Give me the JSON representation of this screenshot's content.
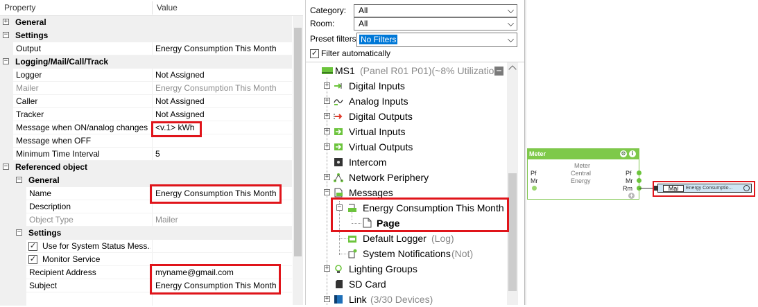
{
  "property_grid": {
    "header": {
      "property": "Property",
      "value": "Value"
    },
    "rows": [
      {
        "label": "General",
        "type": "category",
        "collapsed": true
      },
      {
        "label": "Settings",
        "type": "category"
      },
      {
        "label": "Output",
        "value": "Energy Consumption This Month"
      },
      {
        "label": "Logging/Mail/Call/Track",
        "type": "category"
      },
      {
        "label": "Logger",
        "value": "Not Assigned"
      },
      {
        "label": "Mailer",
        "value": "Energy Consumption This Month",
        "disabled": true
      },
      {
        "label": "Caller",
        "value": "Not Assigned"
      },
      {
        "label": "Tracker",
        "value": "Not Assigned"
      },
      {
        "label": "Message when ON/analog changes",
        "value": "<v.1> kWh"
      },
      {
        "label": "Message when OFF",
        "value": ""
      },
      {
        "label": "Minimum Time Interval",
        "value": "5"
      },
      {
        "label": "Referenced object",
        "type": "category"
      },
      {
        "label": "General",
        "type": "subcategory"
      },
      {
        "label": "Name",
        "value": "Energy Consumption This Month"
      },
      {
        "label": "Description",
        "value": ""
      },
      {
        "label": "Object Type",
        "value": "Mailer",
        "disabled": true
      },
      {
        "label": "Settings",
        "type": "subcategory"
      },
      {
        "label": "Use for System Status Mess...",
        "value": "",
        "checked": true
      },
      {
        "label": "Monitor Service",
        "value": "",
        "checked": true
      },
      {
        "label": "Recipient Address",
        "value": "myname@gmail.com"
      },
      {
        "label": "Subject",
        "value": "Energy Consumption This Month"
      }
    ]
  },
  "filters": {
    "category_label": "Category:",
    "category_value": "All",
    "room_label": "Room:",
    "room_value": "All",
    "preset_label": "Preset filters",
    "preset_value": "No Filters",
    "auto_label": "Filter automatically",
    "auto_checked": true
  },
  "tree": {
    "root": {
      "label": "MS1",
      "detail": "(Panel R01 P01)(~8% Utilization"
    },
    "items": [
      {
        "label": "Digital Inputs",
        "icon": "digital-inputs-icon"
      },
      {
        "label": "Analog Inputs",
        "icon": "analog-inputs-icon"
      },
      {
        "label": "Digital Outputs",
        "icon": "digital-outputs-icon"
      },
      {
        "label": "Virtual Inputs",
        "icon": "virtual-inputs-icon"
      },
      {
        "label": "Virtual Outputs",
        "icon": "virtual-outputs-icon"
      },
      {
        "label": "Intercom",
        "icon": "intercom-icon"
      },
      {
        "label": "Network Periphery",
        "icon": "network-periphery-icon"
      },
      {
        "label": "Messages",
        "icon": "messages-icon"
      }
    ],
    "messages_children": {
      "mailer": "Energy Consumption This Month",
      "page": "Page",
      "logger": "Default Logger",
      "logger_detail": "(Log)",
      "notifications": "System Notifications",
      "notifications_detail": "(Not)"
    },
    "after_items": [
      {
        "label": "Lighting Groups",
        "icon": "lighting-groups-icon"
      },
      {
        "label": "SD Card",
        "icon": "sd-card-icon"
      },
      {
        "label": "Link",
        "detail": "(3/30 Devices)",
        "icon": "link-icon"
      }
    ]
  },
  "canvas": {
    "meter_block": {
      "title": "Meter",
      "subtitle": "Meter",
      "left_inputs": [
        "Pf",
        "Mr"
      ],
      "center_labels": [
        "Central",
        "Energy"
      ],
      "right_outputs": [
        "Pf",
        "Mr",
        "Rm"
      ]
    },
    "mail_block": {
      "label": "Mai",
      "text": "Energy Consumptio..."
    }
  },
  "colors": {
    "highlight": "#e0141a",
    "selection": "#0078d7",
    "block_green": "#7ec94a",
    "mail_block": "#cfe6f5"
  }
}
